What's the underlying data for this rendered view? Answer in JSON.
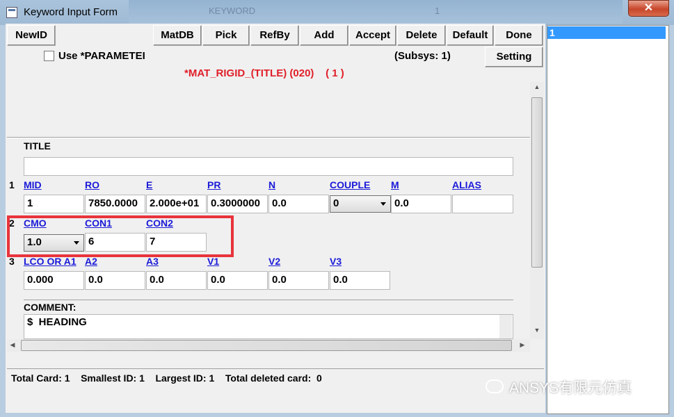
{
  "window": {
    "title": "Keyword Input Form",
    "close_label": "✕",
    "background_title": "KEYWORD",
    "background_num": "1"
  },
  "toolbar": {
    "newid": "NewID",
    "matdb": "MatDB",
    "pick": "Pick",
    "refby": "RefBy",
    "add": "Add",
    "accept": "Accept",
    "delete": "Delete",
    "default": "Default",
    "done": "Done",
    "setting": "Setting"
  },
  "options": {
    "use_parameter_label": "Use *PARAMETEI",
    "use_parameter_checked": false,
    "subsys": "(Subsys: 1)"
  },
  "keyword_title": "*MAT_RIGID_(TITLE) (020)    ( 1 )",
  "title_section": {
    "label": "TITLE",
    "value": ""
  },
  "card1": {
    "row": "1",
    "labels": [
      "MID",
      "RO",
      "E",
      "PR",
      "N",
      "COUPLE",
      "M",
      "ALIAS"
    ],
    "values": [
      "1",
      "7850.0000",
      "2.000e+01",
      "0.3000000",
      "0.0",
      "0",
      "0.0",
      ""
    ]
  },
  "card2": {
    "row": "2",
    "labels": [
      "CMO",
      "CON1",
      "CON2"
    ],
    "values": [
      "1.0",
      "6",
      "7"
    ]
  },
  "card3": {
    "row": "3",
    "labels": [
      "LCO OR A1",
      "A2",
      "A3",
      "V1",
      "V2",
      "V3"
    ],
    "values": [
      "0.000",
      "0.0",
      "0.0",
      "0.0",
      "0.0",
      "0.0"
    ]
  },
  "comment": {
    "label": "COMMENT:",
    "value": "$  HEADING"
  },
  "status": "Total Card: 1    Smallest ID: 1    Largest ID: 1    Total deleted card:  0",
  "id_list": [
    "1"
  ],
  "watermark": "ANSYS有限元仿真",
  "colors": {
    "keyword_title": "#e0202a",
    "link": "#1a1ad8",
    "highlight_box": "#e8343c",
    "list_selection": "#3399ff"
  }
}
